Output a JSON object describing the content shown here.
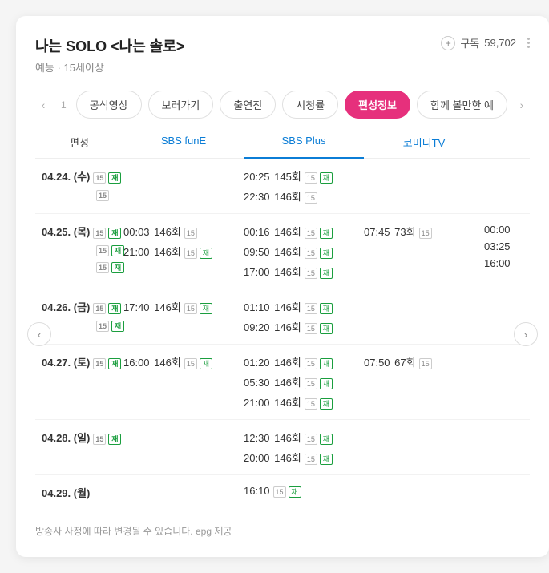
{
  "header": {
    "title": "나는 SOLO <나는 솔로>",
    "genre": "예능",
    "rating": "15세이상",
    "subscribe_label": "구독",
    "subscribe_count": "59,702"
  },
  "tabs": {
    "page_indicator": "1",
    "items": [
      "공식영상",
      "보러가기",
      "출연진",
      "시청률",
      "편성정보",
      "함께 볼만한 예"
    ],
    "active_index": 4
  },
  "schedule": {
    "headers": [
      "편성",
      "SBS funE",
      "SBS Plus",
      "코미디TV"
    ],
    "active_channel_index": 2,
    "rows": [
      {
        "date": "04.24. (수)",
        "date_badges": [
          [
            "15",
            "재"
          ],
          [
            "15"
          ]
        ],
        "cells": [
          [],
          [
            {
              "time": "20:25",
              "ep": "145회",
              "badges": [
                "15",
                "재"
              ]
            },
            {
              "time": "22:30",
              "ep": "146회",
              "badges": [
                "15"
              ]
            }
          ],
          []
        ],
        "overflow": []
      },
      {
        "date": "04.25. (목)",
        "date_badges": [
          [
            "15",
            "재"
          ],
          [
            "15",
            "재"
          ],
          [
            "15",
            "재"
          ]
        ],
        "cells": [
          [
            {
              "time": "00:03",
              "ep": "146회",
              "badges": [
                "15"
              ]
            },
            {
              "time": "21:00",
              "ep": "146회",
              "badges": [
                "15",
                "재"
              ]
            }
          ],
          [
            {
              "time": "00:16",
              "ep": "146회",
              "badges": [
                "15",
                "재"
              ]
            },
            {
              "time": "09:50",
              "ep": "146회",
              "badges": [
                "15",
                "재"
              ]
            },
            {
              "time": "17:00",
              "ep": "146회",
              "badges": [
                "15",
                "재"
              ]
            }
          ],
          [
            {
              "time": "07:45",
              "ep": "73회",
              "badges": [
                "15"
              ]
            }
          ]
        ],
        "overflow": [
          "00:00",
          "03:25",
          "16:00"
        ]
      },
      {
        "date": "04.26. (금)",
        "date_badges": [
          [
            "15",
            "재"
          ],
          [
            "15",
            "재"
          ]
        ],
        "cells": [
          [
            {
              "time": "17:40",
              "ep": "146회",
              "badges": [
                "15",
                "재"
              ]
            }
          ],
          [
            {
              "time": "01:10",
              "ep": "146회",
              "badges": [
                "15",
                "재"
              ]
            },
            {
              "time": "09:20",
              "ep": "146회",
              "badges": [
                "15",
                "재"
              ]
            }
          ],
          []
        ],
        "overflow": []
      },
      {
        "date": "04.27. (토)",
        "date_badges": [
          [
            "15",
            "재"
          ]
        ],
        "cells": [
          [
            {
              "time": "16:00",
              "ep": "146회",
              "badges": [
                "15",
                "재"
              ]
            }
          ],
          [
            {
              "time": "01:20",
              "ep": "146회",
              "badges": [
                "15",
                "재"
              ]
            },
            {
              "time": "05:30",
              "ep": "146회",
              "badges": [
                "15",
                "재"
              ]
            },
            {
              "time": "21:00",
              "ep": "146회",
              "badges": [
                "15",
                "재"
              ]
            }
          ],
          [
            {
              "time": "07:50",
              "ep": "67회",
              "badges": [
                "15"
              ]
            }
          ]
        ],
        "overflow": []
      },
      {
        "date": "04.28. (일)",
        "date_badges": [
          [
            "15",
            "재"
          ]
        ],
        "cells": [
          [],
          [
            {
              "time": "12:30",
              "ep": "146회",
              "badges": [
                "15",
                "재"
              ]
            },
            {
              "time": "20:00",
              "ep": "146회",
              "badges": [
                "15",
                "재"
              ]
            }
          ],
          []
        ],
        "overflow": []
      },
      {
        "date": "04.29. (월)",
        "date_badges": [],
        "cells": [
          [],
          [
            {
              "time": "16:10",
              "ep": "",
              "badges": [
                "15",
                "재"
              ]
            }
          ],
          []
        ],
        "overflow": []
      }
    ]
  },
  "footer": {
    "note": "방송사 사정에 따라 변경될 수 있습니다. epg 제공"
  },
  "badge_labels": {
    "15": "15",
    "재": "재"
  }
}
